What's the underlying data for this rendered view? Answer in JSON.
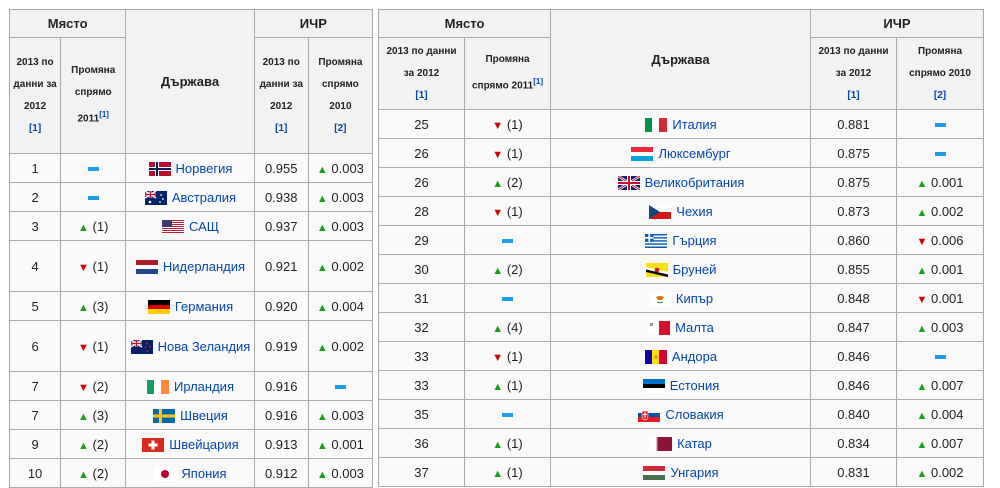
{
  "headers": {
    "place": "Място",
    "country": "Държава",
    "hdi": "ИЧР",
    "rank_2013_left": "2013 по данни за 2012",
    "rank_change_left": "Промяна спрямо 2011",
    "hdi_2013_left": "2013 по данни за 2012",
    "hdi_change_left": "Промяна спрямо 2010",
    "rank_2013_right": "2013 по данни за 2012",
    "rank_change_right": "Промяна спрямо 2011",
    "hdi_2013_right": "2013 по данни за 2012",
    "hdi_change_right": "Промяна спрямо 2010",
    "ref1": "[1]",
    "ref2": "[2]"
  },
  "left_rows": [
    {
      "rank": "1",
      "rank_dir": "same",
      "rank_change": "",
      "country": "Норвегия",
      "flag": "norway",
      "hdi": "0.955",
      "hdi_dir": "up",
      "hdi_change": "0.003"
    },
    {
      "rank": "2",
      "rank_dir": "same",
      "rank_change": "",
      "country": "Австралия",
      "flag": "australia",
      "hdi": "0.938",
      "hdi_dir": "up",
      "hdi_change": "0.003"
    },
    {
      "rank": "3",
      "rank_dir": "up",
      "rank_change": "(1)",
      "country": "САЩ",
      "flag": "usa",
      "hdi": "0.937",
      "hdi_dir": "up",
      "hdi_change": "0.003"
    },
    {
      "rank": "4",
      "rank_dir": "down",
      "rank_change": "(1)",
      "country": "Нидерландия",
      "flag": "netherlands",
      "hdi": "0.921",
      "hdi_dir": "up",
      "hdi_change": "0.002"
    },
    {
      "rank": "5",
      "rank_dir": "up",
      "rank_change": "(3)",
      "country": "Германия",
      "flag": "germany",
      "hdi": "0.920",
      "hdi_dir": "up",
      "hdi_change": "0.004"
    },
    {
      "rank": "6",
      "rank_dir": "down",
      "rank_change": "(1)",
      "country": "Нова Зеландия",
      "flag": "newzealand",
      "hdi": "0.919",
      "hdi_dir": "up",
      "hdi_change": "0.002"
    },
    {
      "rank": "7",
      "rank_dir": "down",
      "rank_change": "(2)",
      "country": "Ирландия",
      "flag": "ireland",
      "hdi": "0.916",
      "hdi_dir": "same",
      "hdi_change": ""
    },
    {
      "rank": "7",
      "rank_dir": "up",
      "rank_change": "(3)",
      "country": "Швеция",
      "flag": "sweden",
      "hdi": "0.916",
      "hdi_dir": "up",
      "hdi_change": "0.003"
    },
    {
      "rank": "9",
      "rank_dir": "up",
      "rank_change": "(2)",
      "country": "Швейцария",
      "flag": "switzerland",
      "hdi": "0.913",
      "hdi_dir": "up",
      "hdi_change": "0.001"
    },
    {
      "rank": "10",
      "rank_dir": "up",
      "rank_change": "(2)",
      "country": "Япония",
      "flag": "japan",
      "hdi": "0.912",
      "hdi_dir": "up",
      "hdi_change": "0.003"
    }
  ],
  "right_rows": [
    {
      "rank": "25",
      "rank_dir": "down",
      "rank_change": "(1)",
      "country": "Италия",
      "flag": "italy",
      "hdi": "0.881",
      "hdi_dir": "same",
      "hdi_change": ""
    },
    {
      "rank": "26",
      "rank_dir": "down",
      "rank_change": "(1)",
      "country": "Люксембург",
      "flag": "luxembourg",
      "hdi": "0.875",
      "hdi_dir": "same",
      "hdi_change": ""
    },
    {
      "rank": "26",
      "rank_dir": "up",
      "rank_change": "(2)",
      "country": "Великобритания",
      "flag": "uk",
      "hdi": "0.875",
      "hdi_dir": "up",
      "hdi_change": "0.001"
    },
    {
      "rank": "28",
      "rank_dir": "down",
      "rank_change": "(1)",
      "country": "Чехия",
      "flag": "czech",
      "hdi": "0.873",
      "hdi_dir": "up",
      "hdi_change": "0.002"
    },
    {
      "rank": "29",
      "rank_dir": "same",
      "rank_change": "",
      "country": "Гърция",
      "flag": "greece",
      "hdi": "0.860",
      "hdi_dir": "down",
      "hdi_change": "0.006"
    },
    {
      "rank": "30",
      "rank_dir": "up",
      "rank_change": "(2)",
      "country": "Бруней",
      "flag": "brunei",
      "hdi": "0.855",
      "hdi_dir": "up",
      "hdi_change": "0.001"
    },
    {
      "rank": "31",
      "rank_dir": "same",
      "rank_change": "",
      "country": "Кипър",
      "flag": "cyprus",
      "hdi": "0.848",
      "hdi_dir": "down",
      "hdi_change": "0.001"
    },
    {
      "rank": "32",
      "rank_dir": "up",
      "rank_change": "(4)",
      "country": "Малта",
      "flag": "malta",
      "hdi": "0.847",
      "hdi_dir": "up",
      "hdi_change": "0.003"
    },
    {
      "rank": "33",
      "rank_dir": "down",
      "rank_change": "(1)",
      "country": "Андора",
      "flag": "andorra",
      "hdi": "0.846",
      "hdi_dir": "same",
      "hdi_change": ""
    },
    {
      "rank": "33",
      "rank_dir": "up",
      "rank_change": "(1)",
      "country": "Естония",
      "flag": "estonia",
      "hdi": "0.846",
      "hdi_dir": "up",
      "hdi_change": "0.007"
    },
    {
      "rank": "35",
      "rank_dir": "same",
      "rank_change": "",
      "country": "Словакия",
      "flag": "slovakia",
      "hdi": "0.840",
      "hdi_dir": "up",
      "hdi_change": "0.004"
    },
    {
      "rank": "36",
      "rank_dir": "up",
      "rank_change": "(1)",
      "country": "Катар",
      "flag": "qatar",
      "hdi": "0.834",
      "hdi_dir": "up",
      "hdi_change": "0.007"
    },
    {
      "rank": "37",
      "rank_dir": "up",
      "rank_change": "(1)",
      "country": "Унгария",
      "flag": "hungary",
      "hdi": "0.831",
      "hdi_dir": "up",
      "hdi_change": "0.002"
    }
  ],
  "colors": {
    "up": "#1b9e1b",
    "down": "#d40000",
    "same": "#1a9ee8",
    "link": "#0645ad"
  }
}
